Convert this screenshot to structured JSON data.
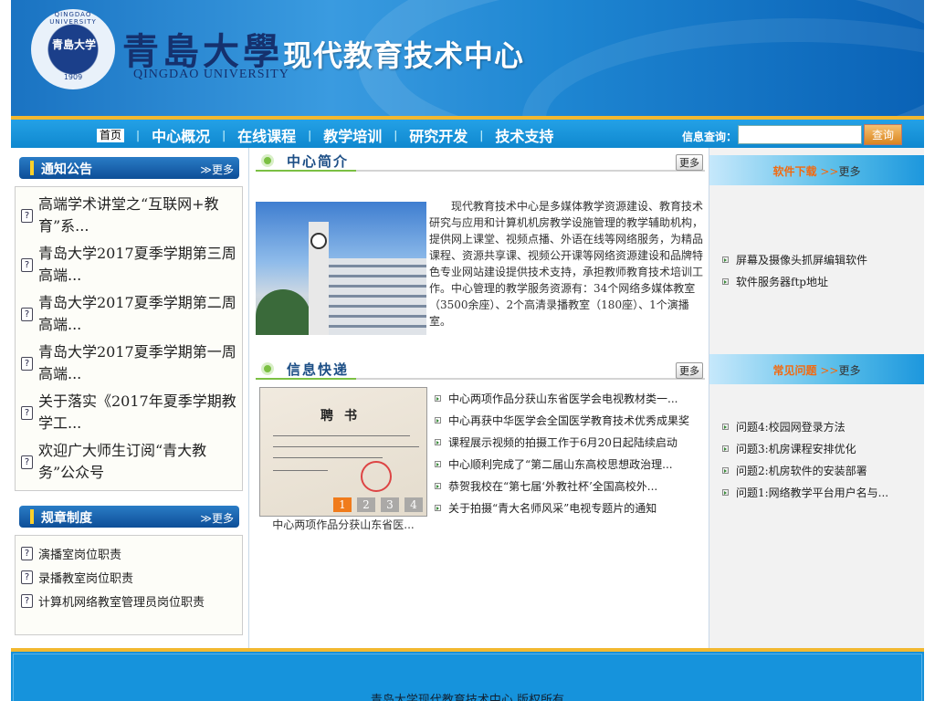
{
  "header": {
    "seal_top": "QINGDAO UNIVERSITY",
    "seal_center": "青島大学",
    "seal_year": "1909",
    "university_cn": "青島大學",
    "university_en": "QINGDAO UNIVERSITY",
    "site_title": "现代教育技术中心"
  },
  "nav": {
    "home": "首页",
    "separator": "|",
    "items": [
      "中心概况",
      "在线课程",
      "教学培训",
      "研究开发",
      "技术支持"
    ],
    "search_label": "信息查询：",
    "search_value": "",
    "search_button": "查询"
  },
  "left": {
    "notice": {
      "title": "通知公告",
      "more": "≫更多",
      "items": [
        "高端学术讲堂之“互联网+教育”系...",
        "青岛大学2017夏季学期第三周高端...",
        "青岛大学2017夏季学期第二周高端...",
        "青岛大学2017夏季学期第一周高端...",
        "关于落实《2017年夏季学期教学工...",
        "欢迎广大师生订阅“青大教务”公众号"
      ]
    },
    "rules": {
      "title": "规章制度",
      "more": "≫更多",
      "items": [
        "演播室岗位职责",
        "录播教室岗位职责",
        "计算机网络教室管理员岗位职责"
      ]
    }
  },
  "middle": {
    "intro": {
      "title": "中心简介",
      "more": "更多",
      "text": "现代教育技术中心是多媒体教学资源建设、教育技术研究与应用和计算机机房教学设施管理的教学辅助机构，提供网上课堂、视频点播、外语在线等网络服务，为精品课程、资源共享课、视频公开课等网络资源建设和品牌特色专业网站建设提供技术支持，承担教师教育技术培训工作。中心管理的教学服务资源有：34个网络多媒体教室（3500余座）、2个高清录播教室（180座）、1个演播室。"
    },
    "news": {
      "title": "信息快递",
      "more": "更多",
      "slider_title": "聘书",
      "slider_dots": [
        "1",
        "2",
        "3",
        "4"
      ],
      "slider_active": 0,
      "slider_caption": "中心两项作品分获山东省医...",
      "items": [
        "中心两项作品分获山东省医学会电视教材类一...",
        "中心再获中华医学会全国医学教育技术优秀成果奖",
        "课程展示视频的拍摄工作于6月20日起陆续启动",
        "中心顺利完成了“第二届山东高校思想政治理...",
        "恭贺我校在“第七届‘外教社杯’全国高校外...",
        "关于拍摄“青大名师风采”电视专题片的通知"
      ]
    }
  },
  "right": {
    "software": {
      "title": "软件下载",
      "arrows": ">>",
      "more": "更多",
      "items": [
        "屏幕及摄像头抓屏编辑软件",
        "软件服务器ftp地址"
      ]
    },
    "faq": {
      "title": "常见问题",
      "arrows": ">>",
      "more": "更多",
      "items": [
        "问题4:校园网登录方法",
        "问题3:机房课程安排优化",
        "问题2:机房软件的安装部署",
        "问题1:网络教学平台用户名与..."
      ]
    }
  },
  "footer": {
    "text": "青岛大学现代教育技术中心  版权所有"
  },
  "colors": {
    "nav_blue": "#1690d8",
    "accent_gold": "#f2b830",
    "orange": "#f26a10",
    "panel_blue": "#0d4e97"
  }
}
